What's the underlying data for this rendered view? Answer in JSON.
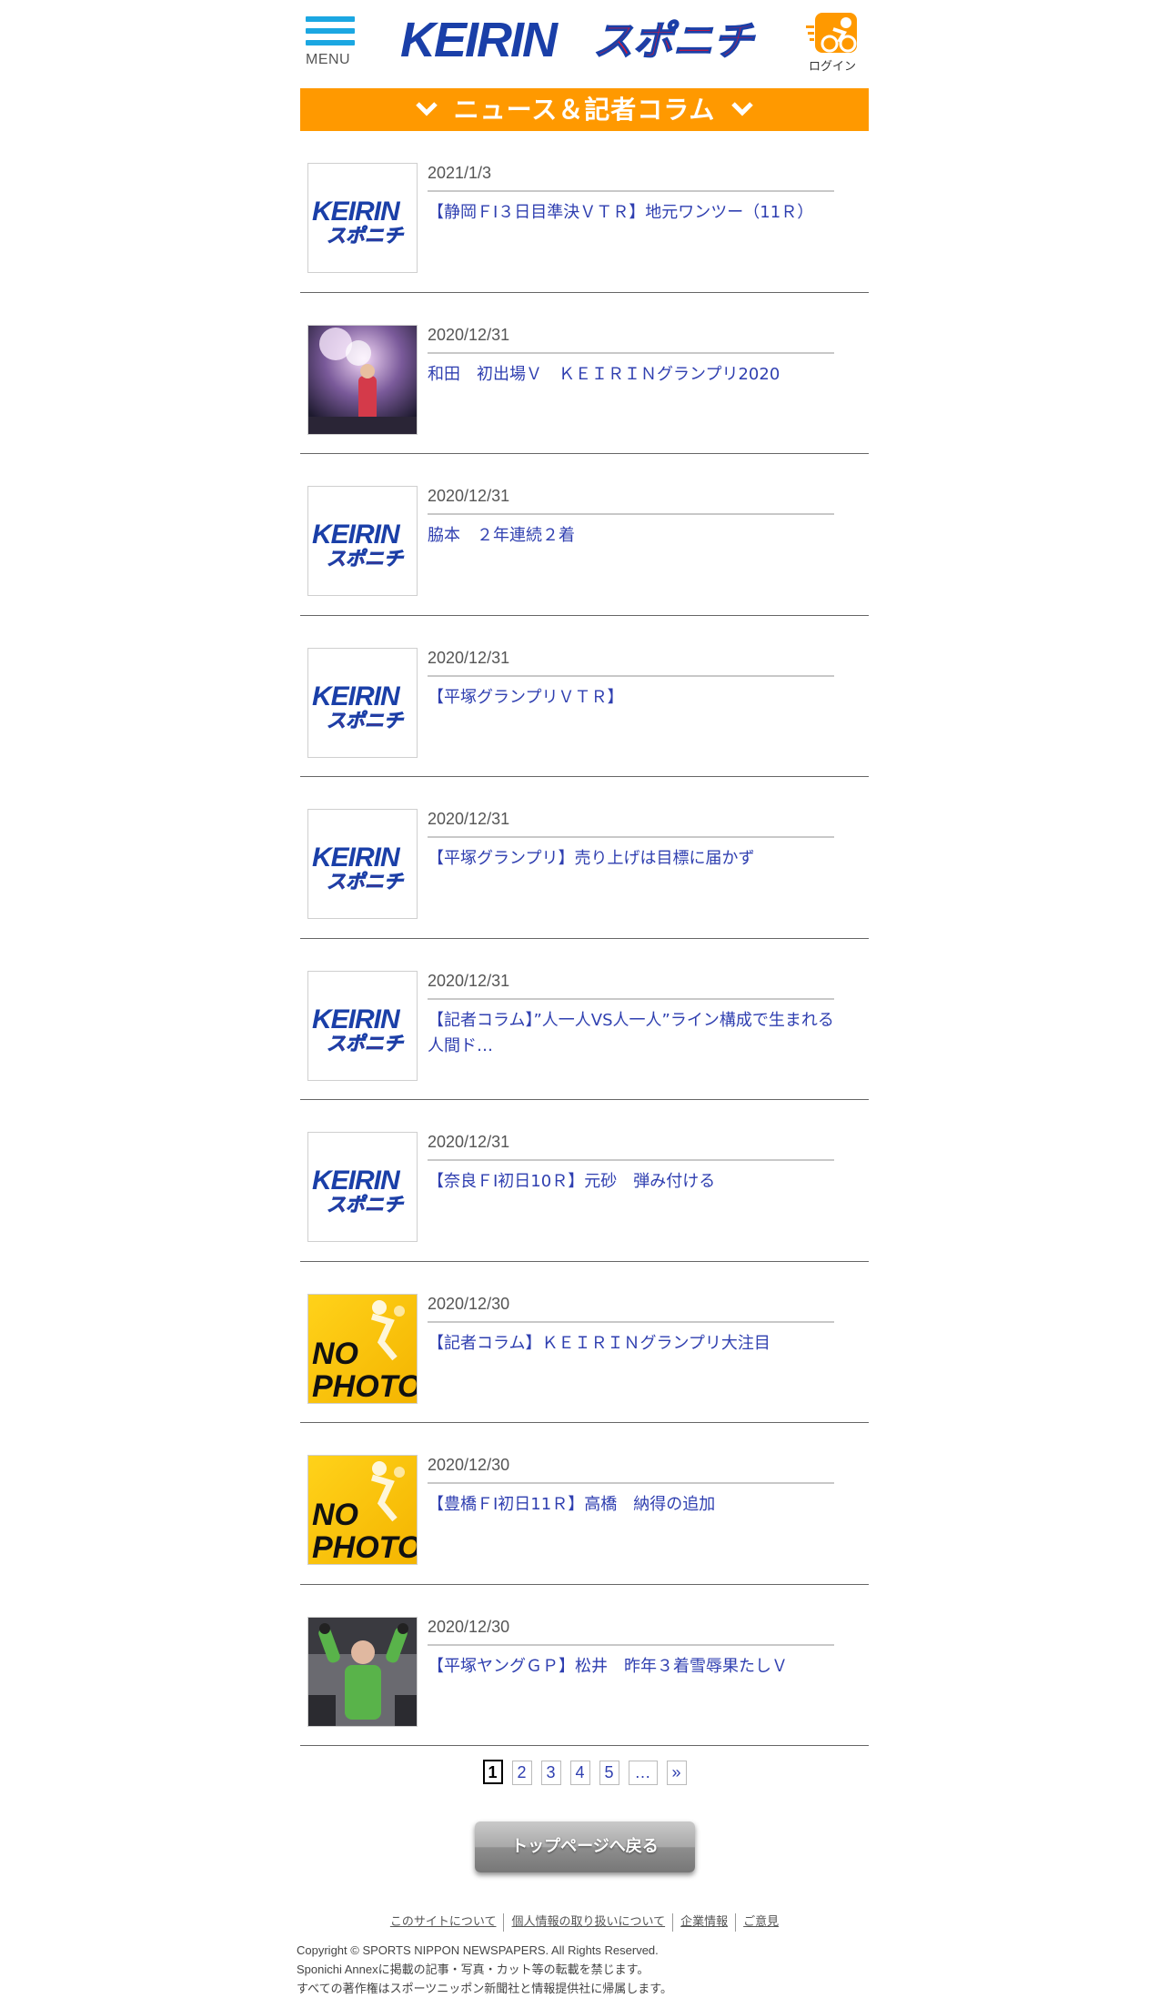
{
  "header": {
    "menu_label": "MENU",
    "login_label": "ログイン",
    "logo_text_latin": "KEIRIN",
    "logo_text_kana": "スポニチ"
  },
  "section": {
    "title": "ニュース＆記者コラム"
  },
  "thumbnail_placeholder": {
    "keirin_logo_latin": "KEIRIN",
    "keirin_logo_kana": "スポニチ",
    "no_photo_line1": "NO",
    "no_photo_line2": "PHOTO"
  },
  "news": [
    {
      "date": "2021/1/3",
      "title": "【静岡ＦⅠ３日目準決ＶＴＲ】地元ワンツー（11Ｒ）",
      "thumb": "keirin-logo"
    },
    {
      "date": "2020/12/31",
      "title": "和田　初出場Ｖ　ＫＥＩＲＩＮグランプリ2020",
      "thumb": "photo-champagne"
    },
    {
      "date": "2020/12/31",
      "title": "脇本　２年連続２着",
      "thumb": "keirin-logo"
    },
    {
      "date": "2020/12/31",
      "title": "【平塚グランプリＶＴＲ】",
      "thumb": "keirin-logo"
    },
    {
      "date": "2020/12/31",
      "title": "【平塚グランプリ】売り上げは目標に届かず",
      "thumb": "keirin-logo"
    },
    {
      "date": "2020/12/31",
      "title": "【記者コラム】”人一人VS人一人”ライン構成で生まれる人間ド…",
      "thumb": "keirin-logo"
    },
    {
      "date": "2020/12/31",
      "title": "【奈良ＦⅠ初日10Ｒ】元砂　弾み付ける",
      "thumb": "keirin-logo"
    },
    {
      "date": "2020/12/30",
      "title": "【記者コラム】ＫＥＩＲＩＮグランプリ大注目",
      "thumb": "no-photo"
    },
    {
      "date": "2020/12/30",
      "title": "【豊橋ＦⅠ初日11Ｒ】高橋　納得の追加",
      "thumb": "no-photo"
    },
    {
      "date": "2020/12/30",
      "title": "【平塚ヤングＧＰ】松井　昨年３着雪辱果たしＶ",
      "thumb": "photo-winner"
    }
  ],
  "pagination": {
    "current": "1",
    "pages": [
      "2",
      "3",
      "4",
      "5"
    ],
    "ellipsis": "…",
    "next": "»"
  },
  "back_button": "トップページへ戻る",
  "footer": {
    "links": [
      "このサイトについて",
      "個人情報の取り扱いについて",
      "企業情報",
      "ご意見"
    ],
    "copyright": "Copyright © SPORTS NIPPON NEWSPAPERS. All Rights Reserved.",
    "notice1": "Sponichi Annexに掲載の記事・写真・カット等の転載を禁じます。",
    "notice2": "すべての著作権はスポーツニッポン新聞社と情報提供社に帰属します。"
  },
  "colors": {
    "accent_orange": "#ff9900",
    "menu_blue": "#1ba7e2",
    "link_blue": "#2f3fb0",
    "logo_blue": "#1a3fa8",
    "logo_red": "#e8142e"
  }
}
